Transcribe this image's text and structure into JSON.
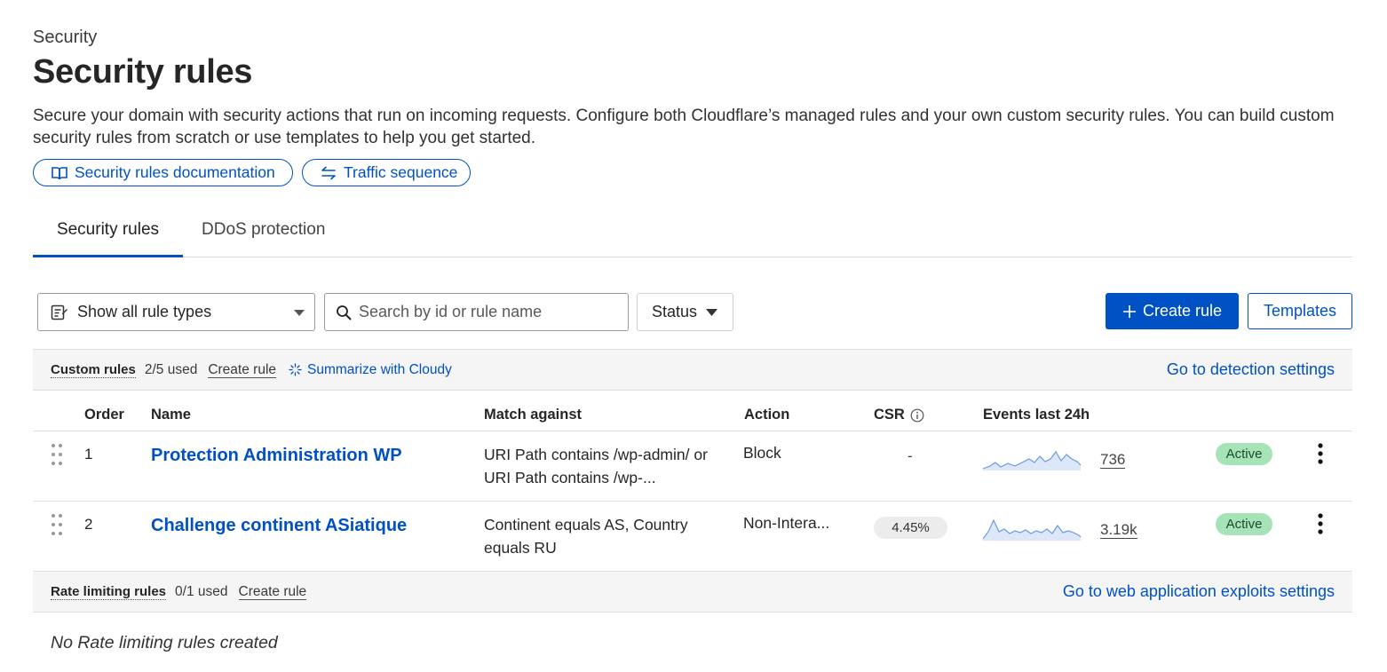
{
  "header": {
    "breadcrumb": "Security",
    "title": "Security rules",
    "description": "Secure your domain with security actions that run on incoming requests. Configure both Cloudflare’s managed rules and your own custom security rules. You can build custom security rules from scratch or use templates to help you get started."
  },
  "links": {
    "docs": "Security rules documentation",
    "traffic": "Traffic sequence"
  },
  "tabs": [
    {
      "label": "Security rules",
      "active": true
    },
    {
      "label": "DDoS protection",
      "active": false
    }
  ],
  "toolbar": {
    "rule_type_value": "Show all rule types",
    "search_placeholder": "Search by id or rule name",
    "status_label": "Status",
    "create_label": "Create rule",
    "templates_label": "Templates"
  },
  "custom_rules": {
    "title": "Custom rules",
    "used": "2/5 used",
    "create": "Create rule",
    "summarize": "Summarize with Cloudy",
    "settings_link": "Go to detection settings"
  },
  "columns": {
    "order": "Order",
    "name": "Name",
    "match": "Match against",
    "action": "Action",
    "csr": "CSR",
    "events": "Events last 24h"
  },
  "rows": [
    {
      "order": "1",
      "name": "Protection Administration WP",
      "match": "URI Path contains /wp-admin/ or URI Path contains /wp-...",
      "action": "Block",
      "csr": "-",
      "events": "736",
      "status": "Active"
    },
    {
      "order": "2",
      "name": "Challenge continent ASiatique",
      "match": "Continent equals AS, Country equals RU",
      "action": "Non-Intera...",
      "csr": "4.45%",
      "events": "3.19k",
      "status": "Active"
    }
  ],
  "rate_limiting": {
    "title": "Rate limiting rules",
    "used": "0/1 used",
    "create": "Create rule",
    "settings_link": "Go to web application exploits settings",
    "empty": "No Rate limiting rules created"
  },
  "colors": {
    "accent": "#0051c3",
    "active_badge": "#a6e4b7",
    "sparkline": "#6a9ae0"
  }
}
